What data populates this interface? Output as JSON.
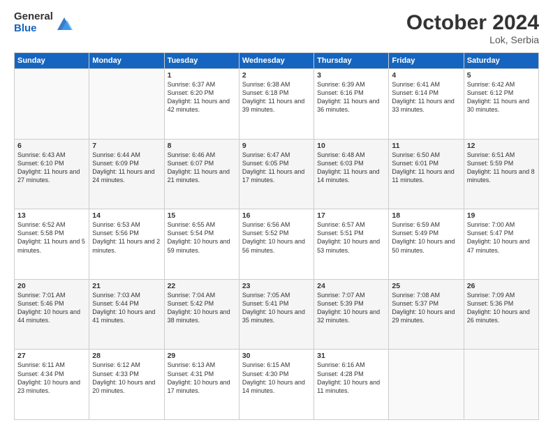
{
  "header": {
    "logo_general": "General",
    "logo_blue": "Blue",
    "month": "October 2024",
    "location": "Lok, Serbia"
  },
  "calendar": {
    "days_header": [
      "Sunday",
      "Monday",
      "Tuesday",
      "Wednesday",
      "Thursday",
      "Friday",
      "Saturday"
    ],
    "rows": [
      [
        {
          "day": "",
          "info": ""
        },
        {
          "day": "",
          "info": ""
        },
        {
          "day": "1",
          "info": "Sunrise: 6:37 AM\nSunset: 6:20 PM\nDaylight: 11 hours\nand 42 minutes."
        },
        {
          "day": "2",
          "info": "Sunrise: 6:38 AM\nSunset: 6:18 PM\nDaylight: 11 hours\nand 39 minutes."
        },
        {
          "day": "3",
          "info": "Sunrise: 6:39 AM\nSunset: 6:16 PM\nDaylight: 11 hours\nand 36 minutes."
        },
        {
          "day": "4",
          "info": "Sunrise: 6:41 AM\nSunset: 6:14 PM\nDaylight: 11 hours\nand 33 minutes."
        },
        {
          "day": "5",
          "info": "Sunrise: 6:42 AM\nSunset: 6:12 PM\nDaylight: 11 hours\nand 30 minutes."
        }
      ],
      [
        {
          "day": "6",
          "info": "Sunrise: 6:43 AM\nSunset: 6:10 PM\nDaylight: 11 hours\nand 27 minutes."
        },
        {
          "day": "7",
          "info": "Sunrise: 6:44 AM\nSunset: 6:09 PM\nDaylight: 11 hours\nand 24 minutes."
        },
        {
          "day": "8",
          "info": "Sunrise: 6:46 AM\nSunset: 6:07 PM\nDaylight: 11 hours\nand 21 minutes."
        },
        {
          "day": "9",
          "info": "Sunrise: 6:47 AM\nSunset: 6:05 PM\nDaylight: 11 hours\nand 17 minutes."
        },
        {
          "day": "10",
          "info": "Sunrise: 6:48 AM\nSunset: 6:03 PM\nDaylight: 11 hours\nand 14 minutes."
        },
        {
          "day": "11",
          "info": "Sunrise: 6:50 AM\nSunset: 6:01 PM\nDaylight: 11 hours\nand 11 minutes."
        },
        {
          "day": "12",
          "info": "Sunrise: 6:51 AM\nSunset: 5:59 PM\nDaylight: 11 hours\nand 8 minutes."
        }
      ],
      [
        {
          "day": "13",
          "info": "Sunrise: 6:52 AM\nSunset: 5:58 PM\nDaylight: 11 hours\nand 5 minutes."
        },
        {
          "day": "14",
          "info": "Sunrise: 6:53 AM\nSunset: 5:56 PM\nDaylight: 11 hours\nand 2 minutes."
        },
        {
          "day": "15",
          "info": "Sunrise: 6:55 AM\nSunset: 5:54 PM\nDaylight: 10 hours\nand 59 minutes."
        },
        {
          "day": "16",
          "info": "Sunrise: 6:56 AM\nSunset: 5:52 PM\nDaylight: 10 hours\nand 56 minutes."
        },
        {
          "day": "17",
          "info": "Sunrise: 6:57 AM\nSunset: 5:51 PM\nDaylight: 10 hours\nand 53 minutes."
        },
        {
          "day": "18",
          "info": "Sunrise: 6:59 AM\nSunset: 5:49 PM\nDaylight: 10 hours\nand 50 minutes."
        },
        {
          "day": "19",
          "info": "Sunrise: 7:00 AM\nSunset: 5:47 PM\nDaylight: 10 hours\nand 47 minutes."
        }
      ],
      [
        {
          "day": "20",
          "info": "Sunrise: 7:01 AM\nSunset: 5:46 PM\nDaylight: 10 hours\nand 44 minutes."
        },
        {
          "day": "21",
          "info": "Sunrise: 7:03 AM\nSunset: 5:44 PM\nDaylight: 10 hours\nand 41 minutes."
        },
        {
          "day": "22",
          "info": "Sunrise: 7:04 AM\nSunset: 5:42 PM\nDaylight: 10 hours\nand 38 minutes."
        },
        {
          "day": "23",
          "info": "Sunrise: 7:05 AM\nSunset: 5:41 PM\nDaylight: 10 hours\nand 35 minutes."
        },
        {
          "day": "24",
          "info": "Sunrise: 7:07 AM\nSunset: 5:39 PM\nDaylight: 10 hours\nand 32 minutes."
        },
        {
          "day": "25",
          "info": "Sunrise: 7:08 AM\nSunset: 5:37 PM\nDaylight: 10 hours\nand 29 minutes."
        },
        {
          "day": "26",
          "info": "Sunrise: 7:09 AM\nSunset: 5:36 PM\nDaylight: 10 hours\nand 26 minutes."
        }
      ],
      [
        {
          "day": "27",
          "info": "Sunrise: 6:11 AM\nSunset: 4:34 PM\nDaylight: 10 hours\nand 23 minutes."
        },
        {
          "day": "28",
          "info": "Sunrise: 6:12 AM\nSunset: 4:33 PM\nDaylight: 10 hours\nand 20 minutes."
        },
        {
          "day": "29",
          "info": "Sunrise: 6:13 AM\nSunset: 4:31 PM\nDaylight: 10 hours\nand 17 minutes."
        },
        {
          "day": "30",
          "info": "Sunrise: 6:15 AM\nSunset: 4:30 PM\nDaylight: 10 hours\nand 14 minutes."
        },
        {
          "day": "31",
          "info": "Sunrise: 6:16 AM\nSunset: 4:28 PM\nDaylight: 10 hours\nand 11 minutes."
        },
        {
          "day": "",
          "info": ""
        },
        {
          "day": "",
          "info": ""
        }
      ]
    ]
  }
}
